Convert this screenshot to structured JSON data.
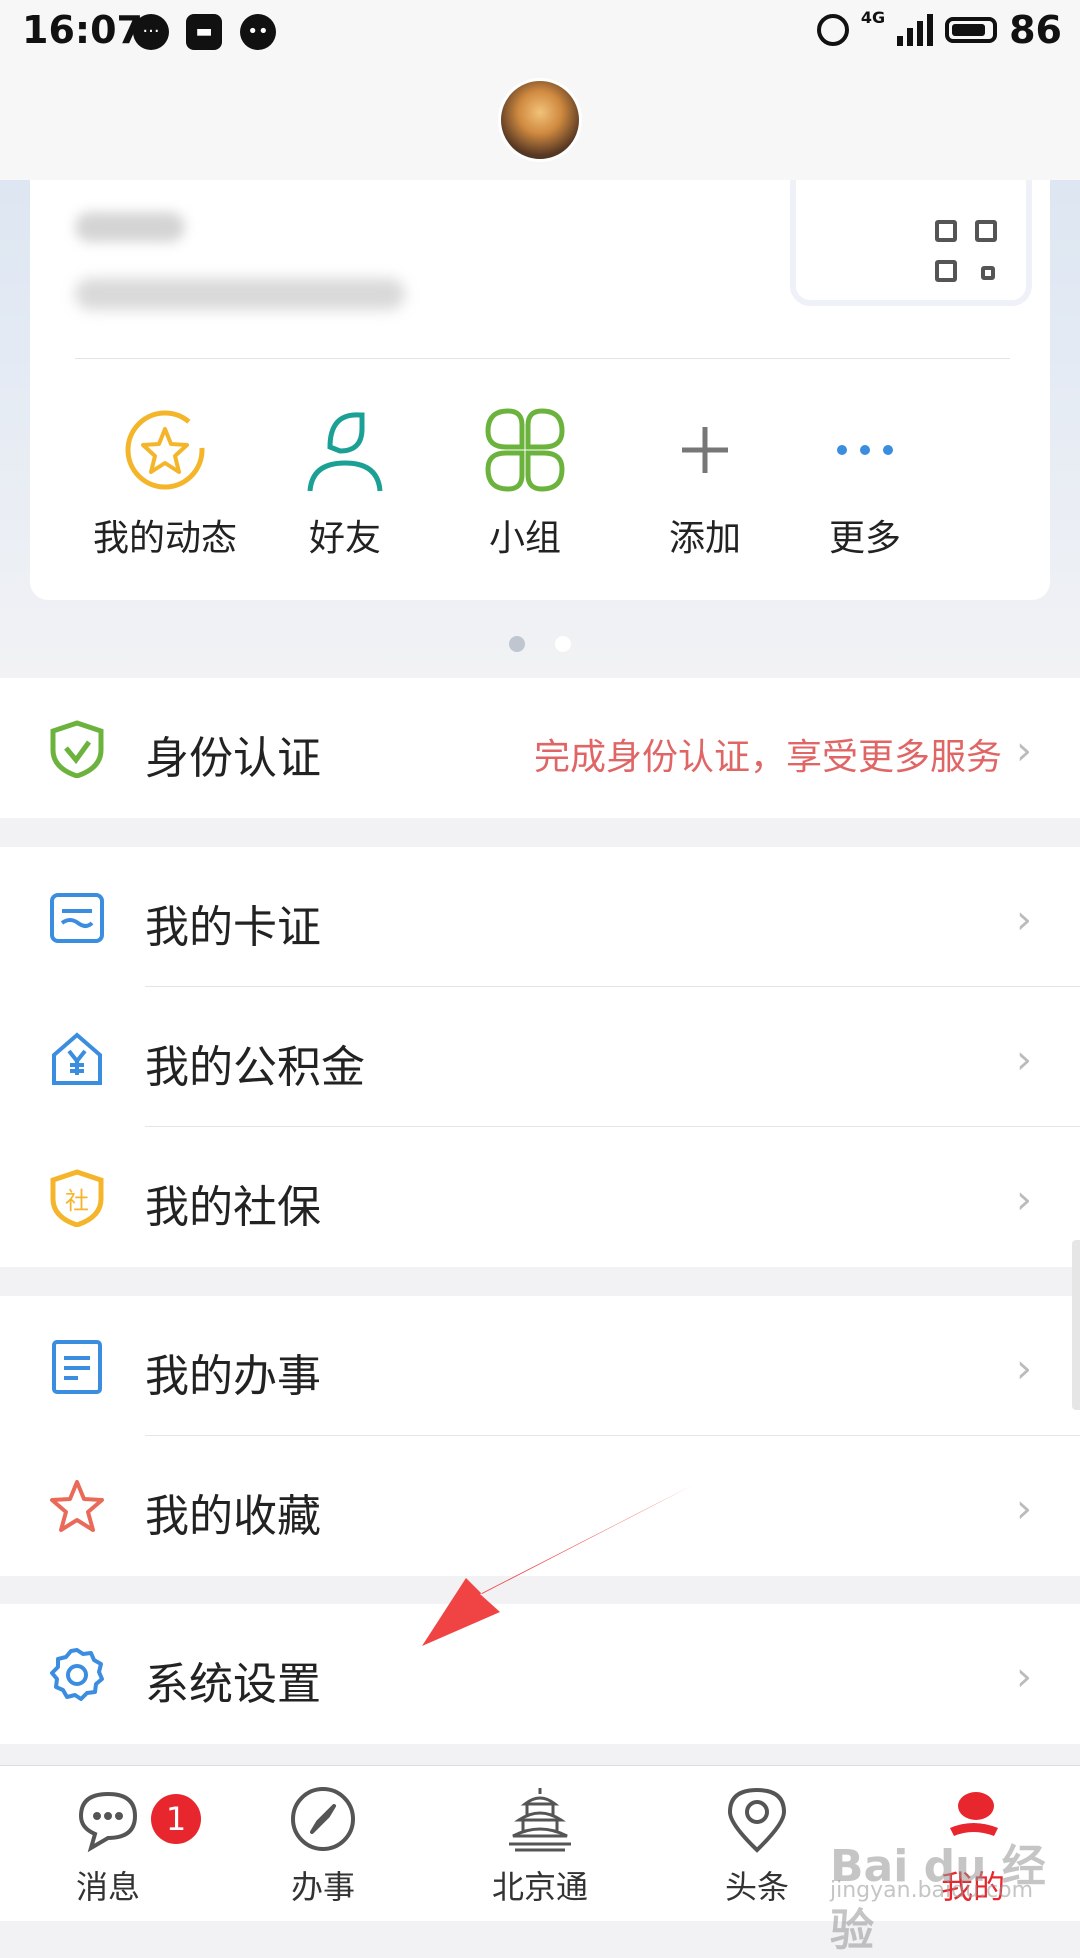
{
  "status_bar": {
    "time": "16:07",
    "network": "4G",
    "battery": "86"
  },
  "profile": {
    "shortcuts": [
      {
        "label": "我的动态",
        "icon": "star-refresh-icon"
      },
      {
        "label": "好友",
        "icon": "person-icon"
      },
      {
        "label": "小组",
        "icon": "group-icon"
      },
      {
        "label": "添加",
        "icon": "plus-icon"
      },
      {
        "label": "更多",
        "icon": "more-dots-icon"
      }
    ]
  },
  "identity": {
    "label": "身份认证",
    "hint": "完成身份认证，享受更多服务"
  },
  "cards_section": [
    {
      "label": "我的卡证",
      "icon": "card-icon"
    },
    {
      "label": "我的公积金",
      "icon": "housing-fund-icon"
    },
    {
      "label": "我的社保",
      "icon": "social-security-icon"
    }
  ],
  "work_section": [
    {
      "label": "我的办事",
      "icon": "document-icon"
    },
    {
      "label": "我的收藏",
      "icon": "star-icon"
    }
  ],
  "settings": {
    "label": "系统设置",
    "icon": "gear-icon"
  },
  "chevron": "›",
  "bottom_nav": [
    {
      "label": "消息",
      "icon": "chat-bubble-icon",
      "badge": "1"
    },
    {
      "label": "办事",
      "icon": "compass-icon"
    },
    {
      "label": "北京通",
      "icon": "temple-icon"
    },
    {
      "label": "头条",
      "icon": "location-pin-icon"
    },
    {
      "label": "我的",
      "icon": "profile-logo-icon",
      "active": true
    }
  ],
  "colors": {
    "accent": "#e8262d",
    "hint": "#e06666",
    "green": "#6cb33e",
    "blue": "#3b8de0",
    "yellow": "#f5b52a"
  },
  "watermark": {
    "main": "Bai du 经验",
    "sub": "jingyan.baidu.com"
  }
}
